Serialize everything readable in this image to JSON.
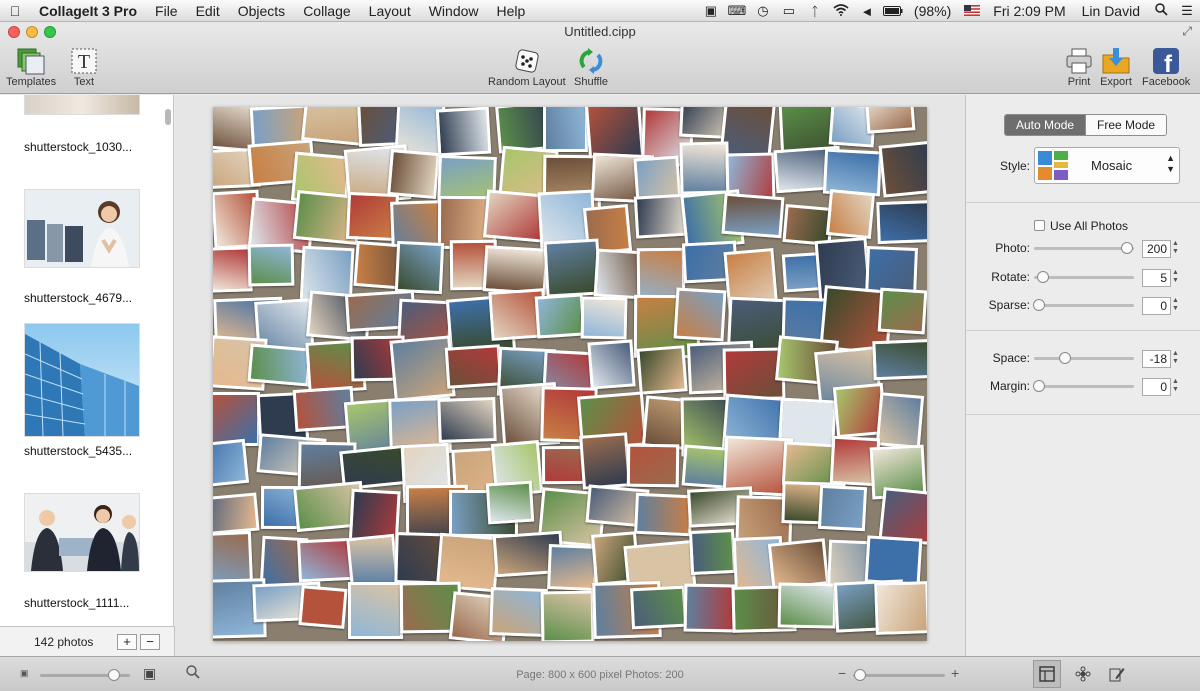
{
  "menubar": {
    "app_name": "CollageIt 3 Pro",
    "menus": [
      "File",
      "Edit",
      "Objects",
      "Collage",
      "Layout",
      "Window",
      "Help"
    ],
    "battery": "(98%)",
    "clock": "Fri 2:09 PM",
    "user": "Lin David"
  },
  "window": {
    "title": "Untitled.cipp"
  },
  "toolbar": {
    "templates_label": "Templates",
    "text_label": "Text",
    "random_layout_label": "Random Layout",
    "shuffle_label": "Shuffle",
    "print_label": "Print",
    "export_label": "Export",
    "facebook_label": "Facebook"
  },
  "sidebar": {
    "items": [
      {
        "label": "shutterstock_1030..."
      },
      {
        "label": "shutterstock_4679..."
      },
      {
        "label": "shutterstock_5435..."
      },
      {
        "label": "shutterstock_1111..."
      }
    ],
    "photo_count": "142 photos",
    "add_label": "+",
    "remove_label": "−"
  },
  "panel": {
    "auto_mode_label": "Auto Mode",
    "free_mode_label": "Free Mode",
    "style_label": "Style:",
    "style_value": "Mosaic",
    "use_all_photos_label": "Use All Photos",
    "photo_label": "Photo:",
    "photo_value": "200",
    "photo_level": 1.0,
    "rotate_label": "Rotate:",
    "rotate_value": "5",
    "rotate_level": 0.05,
    "sparse_label": "Sparse:",
    "sparse_value": "0",
    "sparse_level": 0.0,
    "space_label": "Space:",
    "space_value": "-18",
    "space_level": 0.3,
    "margin_label": "Margin:",
    "margin_value": "0",
    "margin_level": 0.0
  },
  "statusbar": {
    "status_text": "Page: 800 x 600 pixel Photos: 200",
    "zoom_minus": "−",
    "zoom_plus": "+"
  },
  "colors": {
    "selected_segment": "#6e6e6e",
    "facebook_blue": "#3b5998"
  }
}
